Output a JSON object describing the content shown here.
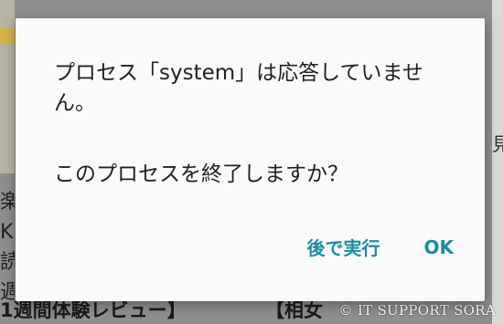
{
  "dialog": {
    "message": "プロセス「system」は応答していません。",
    "question": "このプロセスを終了しますか？",
    "wait_button": "後で実行",
    "ok_button": "OK"
  },
  "background": {
    "left_text": "楽眼\nKin\n読み\n週間",
    "right_text": "見",
    "bottom_left_text": "1週間体験レビュー】",
    "bottom_right_text": "【相女"
  },
  "watermark": "© IT SUPPORT SORA",
  "colors": {
    "accent": "#1a8fa0",
    "text": "#212121",
    "dialog_bg": "#fafafa",
    "scrim": "#8f8f8f"
  }
}
